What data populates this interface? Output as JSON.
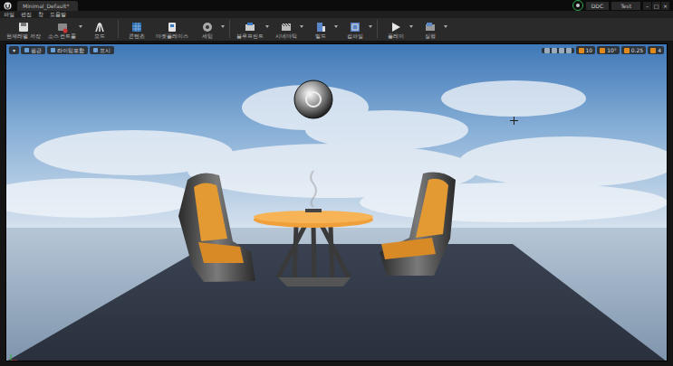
{
  "window": {
    "title": "Minimal_Default*",
    "badge": "DDC",
    "project": "Test",
    "controls": [
      "–",
      "□",
      "×"
    ]
  },
  "menu": [
    "파일",
    "편집",
    "창",
    "도움말"
  ],
  "toolbar": [
    {
      "label": "현재레벨 저장",
      "kind": "plain"
    },
    {
      "label": "소스 컨트롤",
      "kind": "dropdown"
    },
    {
      "label": "모드",
      "kind": "plain"
    },
    {
      "label": "콘텐츠",
      "kind": "plain"
    },
    {
      "label": "마켓플레이스",
      "kind": "plain"
    },
    {
      "label": "세팅",
      "kind": "dropdown"
    },
    {
      "label": "블루프린트",
      "kind": "dropdown"
    },
    {
      "label": "시네마틱",
      "kind": "dropdown"
    },
    {
      "label": "빌드",
      "kind": "dropdown"
    },
    {
      "label": "컴파일",
      "kind": "dropdown"
    },
    {
      "label": "플레이",
      "kind": "dropdown"
    },
    {
      "label": "실행",
      "kind": "dropdown"
    }
  ],
  "viewport": {
    "left": [
      "▾",
      "원근",
      "라이팅포함",
      "표시"
    ],
    "right": [
      "10",
      "10°",
      "0.25",
      "4"
    ]
  }
}
